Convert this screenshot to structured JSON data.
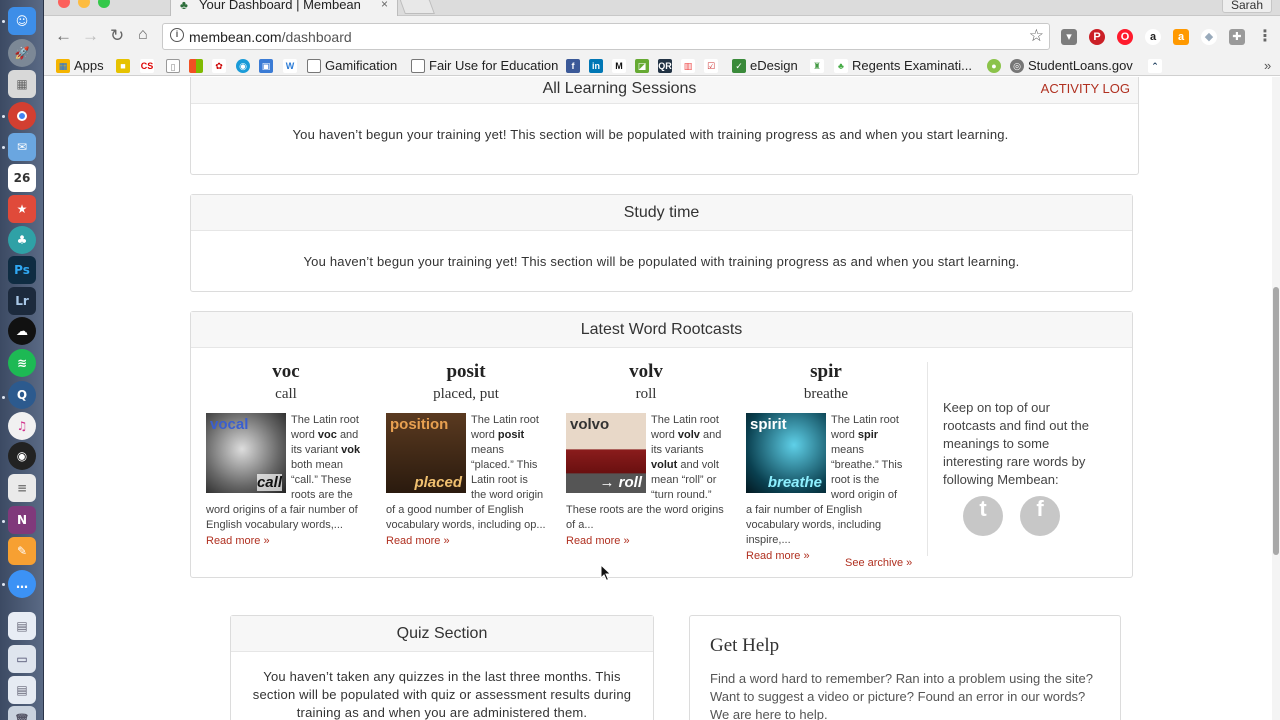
{
  "browser": {
    "tab_title": "Your Dashboard | Membean",
    "tab_close": "×",
    "user_name": "Sarah",
    "url_host": "membean.com",
    "url_path": "/dashboard"
  },
  "bookmarks": [
    {
      "label": "Apps"
    },
    {
      "label": "Gamification"
    },
    {
      "label": "Fair Use for Education"
    },
    {
      "label": "eDesign"
    },
    {
      "label": "Regents Examinati..."
    },
    {
      "label": "StudentLoans.gov"
    }
  ],
  "dock": {
    "calendar_date": "26"
  },
  "sessions": {
    "title": "All Learning Sessions",
    "activity_log": "ACTIVITY LOG",
    "message": "You haven’t begun your training yet! This section will be populated with training progress as and when you start learning."
  },
  "study_time": {
    "title": "Study time",
    "message": "You haven’t begun your training yet! This section will be populated with training progress as and when you start learning."
  },
  "rootcasts": {
    "title": "Latest Word Rootcasts",
    "read_more": "Read more »",
    "see_archive": "See archive »",
    "follow_text": "Keep on top of our rootcasts and find out the meanings to some interesting rare words by following Membean:",
    "items": [
      {
        "root": "voc",
        "meaning": "call",
        "img_top": "vocal",
        "img_bottom": "call",
        "lead": "The Latin root word",
        "b1": "voc",
        "mid": "and its variant",
        "b2": "vok",
        "tail": "both mean “call.” These roots are the word origins of a fair number of English vocabulary words,..."
      },
      {
        "root": "posit",
        "meaning": "placed, put",
        "img_top": "position",
        "img_bottom": "placed",
        "lead": "The Latin root word",
        "b1": "posit",
        "mid": "means “placed.” This Latin root is the",
        "b2": "",
        "tail": "word origin of a good number of English vocabulary words, including op..."
      },
      {
        "root": "volv",
        "meaning": "roll",
        "img_top": "volvo",
        "img_bottom": "→ roll",
        "lead": "The Latin root word",
        "b1": "volv",
        "mid": "and its variants",
        "b2": "volut",
        "tail": "and volt mean “roll” or “turn round.” These roots are the word origins of a..."
      },
      {
        "root": "spir",
        "meaning": "breathe",
        "img_top": "spirit",
        "img_bottom": "breathe",
        "lead": "The Latin root word",
        "b1": "spir",
        "mid": "means “breathe.” This root is the word",
        "b2": "",
        "tail": "origin of a fair number of English vocabulary words, including inspire,..."
      }
    ],
    "social": {
      "twitter": "t",
      "facebook": "f"
    }
  },
  "quiz": {
    "title": "Quiz Section",
    "message": "You haven’t taken any quizzes in the last three months. This section will be populated with quiz or assessment results during training as and when you are administered them."
  },
  "help": {
    "title": "Get Help",
    "message": "Find a word hard to remember? Ran into a problem using the site? Want to suggest a video or picture? Found an error in our words? We are here to help."
  },
  "colors": {
    "link_red": "#b03020",
    "panel_border": "#dcdcdc"
  }
}
